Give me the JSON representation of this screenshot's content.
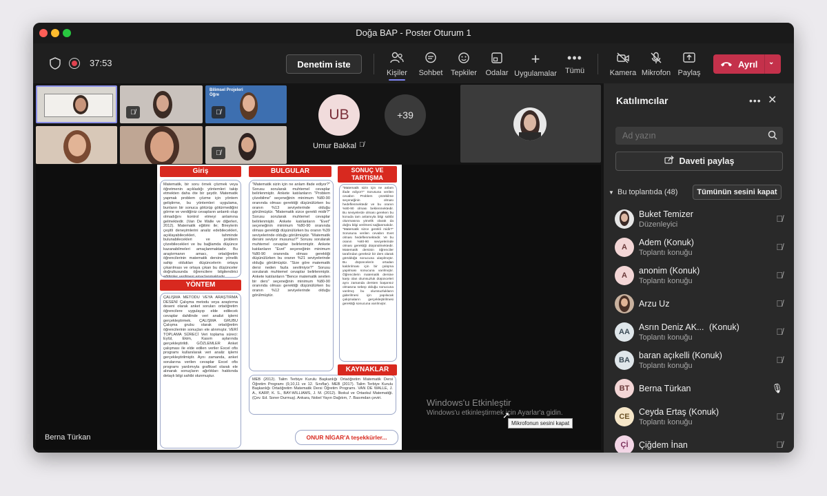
{
  "window": {
    "title": "Doğa BAP - Poster Oturum 1"
  },
  "toolbar": {
    "timer": "37:53",
    "ask_label": "Denetim iste",
    "items": [
      {
        "label": "Kişiler",
        "icon": "people-icon"
      },
      {
        "label": "Sohbet",
        "icon": "chat-icon"
      },
      {
        "label": "Tepkiler",
        "icon": "reactions-icon"
      },
      {
        "label": "Odalar",
        "icon": "rooms-icon"
      },
      {
        "label": "Uygulamalar",
        "icon": "plus-icon"
      },
      {
        "label": "Tümü",
        "icon": "more-icon"
      },
      {
        "label": "Kamera",
        "icon": "camera-off-icon"
      },
      {
        "label": "Mikrofon",
        "icon": "mic-off-icon"
      },
      {
        "label": "Paylaş",
        "icon": "share-icon"
      }
    ],
    "leave_label": "Ayrıl"
  },
  "stage": {
    "tile_label": "Umur Bakkal",
    "tile_initials": "UB",
    "overflow_count": "+39",
    "presenter_name": "Berna Türkan",
    "mini_banner": "Bilimsel Projeleri Öğre",
    "activation_title": "Windows'u Etkinleştir",
    "activation_sub": "Windows'u etkinleştirmek için Ayarlar'a gidin.",
    "tooltip": "Mikrofonun sesini kapat"
  },
  "poster": {
    "sections": {
      "intro": "Giriş",
      "method": "YÖNTEM",
      "results": "BULGULAR",
      "discussion": "SONUÇ VE TARTIŞMA",
      "references": "KAYNAKLAR"
    },
    "thanks": "ONUR NİGAR'A teşekkürler...",
    "intro_text": "Matematik, bir soru örnek çözmek veya öğretmenin açıkladığı yöntemleri takip etmekten daha öte bir şeydir. Matematik yapmak problem çözme için yöntem geliştirme, bu yöntemleri uygulama, bunların bir sonuca götürüp götürmediğini görme ve verdiğiniz cevapların anlamlı olup olmadığını kontrol etmeyi anlamına gelmektedir. (Van De Walle ve diğerleri, 2012). Matematik eğitimi ile; Bireylerin çeşitli deneyimlerini analiz edebilecekleri, açıklayabilecekleri, tahminde bulunabilecekleri ve problem çözebilecekleri ve bu bağlamda düşünce kazanabilmeleri amaçlanmaktadır. Bu araştırmanın amacı, ortaöğretim öğrencilerinin matematik dersine yönelik sahip oldukları düşüncelerin ortaya çıkarılması ve ortaya çıkan bu düşünceler doğrultusunda öğrencilere bilgilendirici eğitimler verilmesi amaçlanmaktadır.",
    "method_text": "ÇALIŞMA METODU VEYA ARAŞTIRMA DESENİ Çalışma metodu veya araştırma deseni olarak anket soruları ortaöğretim öğrencilere uygulayıp elde edilecek cevaplar dahilinde veri analizi işlemi gerçekleştirmek. ÇALIŞMA GRUBU Çalışma grubu olarak ortaöğretim öğrencilerinin sonuçları ele alınmıştır. VERİ TOPLAMA SÜRECİ Veri toplama süreci: Eylül, Ekim, Kasım aylarında gerçekleştirildi. GÖZLEMLER Anket çalışması ile elde edilen veriler Excel ofis programı kullanılarak veri analiz işlemi gerçekleştirilmiştir. Aynı zamanda, anket sorularına verilen cevaplar Excel ofis programı yardımıyla grafiksel olarak ele alınarak sonuçların ağırlıkları hakkında detaylı bilgi sahibi olunmuştur.",
    "results_text": "\"Matematik sizin için ne anlam ifade ediyor?\" Sorusu sorularak muhtemel cevaplar belirlenmiştir. Ankete katılanların \"Problem çözebilme\" seçeneğinin minimum %80-90 oranında olması gerektiği düşünülürken bu oranın %13 seviyelerinde olduğu görülmüştür. \"Matematik sizce gerekli midir?\" Sorusu sorularak muhtemel cevaplar belirlenmiştir. Ankete katılanların \"Evet\" seçeneğinin minimum %80-90 oranında olması gerektiği düşünülürken bu oranın %39 seviyelerinde olduğu görülmüştür. \"Matematik dersini seviyor musunuz?\" Sorusu sorularak muhtemel cevaplar belirlenmiştir. Ankete katılanların \"Evet\" seçeneğinin minimum %80-90 oranında olması gerektiği düşünülürken bu oranın %21 seviyelerinde olduğu görülmüştür. \"Size göre matematik dersi neden fazla sevilmiyor?\" Sorusu sorularak muhtemel cevaplar belirlenmiştir. Ankete katılanların \"Bence matematik sevilen bir ders\" seçeneğinin minimum %80-90 oranında olması gerektiği düşünülürken bu oranın %12 seviyelerinde olduğu görülmüştür.",
    "discussion_text": "\"Matematik sizin için ne anlam ifade ediyor?\" Sorusuna verilen cevabın Problem çözebilme seçeneğinin olması hedeflenmektedir ve bu oranın %80-90 olması beklenmektedir. Bu seviyelerde olması gereken bu konuda tam anlamıyla bilgi sahibi olunmasına yönelik olarak da doğru bilgi verilmesi sağlanmalıdır. \"Matematik sizce gerekli midir?\" Sorusuna verilen cevabın Evet olması hedeflenmektedir. Ve bu oranın %80-90 seviyelerinde olması gerektiği düşünülmektedir. Matematik dersinin öğrenciler tarafından gereksiz bir ders olarak görüldüğü sonucuna ulaşılmıştır. Bu düşüncelerin ortadan kaldırılması için bir çalışma yapılması sonucuna varılmıştır. Öğrencilerin matematik dersine karşı olan olumsuzluk düşünceleri aynı zamanda dersten başarısız olmasına sebep olduğu sonucuna varılmış bu olumsuzlukların giderilmesi için yapılacak çalışmaların gerçekleştirilmesi gerektiği sonucuna varılmıştır.",
    "references_text": "MEB (2012). Talim Terbiye Kurulu Başkanlığı Ortaöğretim Matematik Dersi Öğretim Programı (9,10,11 ve 12. Sınıflar). MEB (2017). Talim Terbiye Kurulu Başkanlığı Ortaöğretim Matematik Dersi Öğretim Programı. VAN DE WALLE, J. A., KARP, K. S., BAY-WILLIAMS, J. M. (2012). İlkokul ve Ortaokul Matematiği. (Çev. Ed. Soner Durmuş). Ankara, Nobel Yayın Dağıtım, 7. Basımdan çeviri."
  },
  "panel": {
    "title": "Katılımcılar",
    "search_placeholder": "Ad yazın",
    "share_label": "Daveti paylaş",
    "section_label": "Bu toplantıda (48)",
    "mute_all_label": "Tümünün sesini kapat",
    "participants": [
      {
        "name": "Buket Temizer",
        "role": "Düzenleyici",
        "initials": "",
        "mic": "muted"
      },
      {
        "name": "Adem (Konuk)",
        "role": "Toplantı konuğu",
        "initials": "A",
        "mic": "muted"
      },
      {
        "name": "anonim (Konuk)",
        "role": "Toplantı konuğu",
        "initials": "A",
        "mic": "muted"
      },
      {
        "name": "Arzu Uz",
        "role": "",
        "initials": "",
        "mic": "muted"
      },
      {
        "name": "Asrın Deniz AK...",
        "name_suffix": "(Konuk)",
        "role": "Toplantı konuğu",
        "initials": "AA",
        "mic": "muted"
      },
      {
        "name": "baran açıkelli (Konuk)",
        "role": "Toplantı konuğu",
        "initials": "BA",
        "mic": "muted"
      },
      {
        "name": "Berna Türkan",
        "role": "",
        "initials": "BT",
        "mic": "on"
      },
      {
        "name": "Ceyda Ertaş (Konuk)",
        "role": "Toplantı konuğu",
        "initials": "CE",
        "mic": "muted"
      },
      {
        "name": "Çiğdem İnan",
        "role": "",
        "initials": "Çİ",
        "mic": "muted"
      }
    ]
  }
}
